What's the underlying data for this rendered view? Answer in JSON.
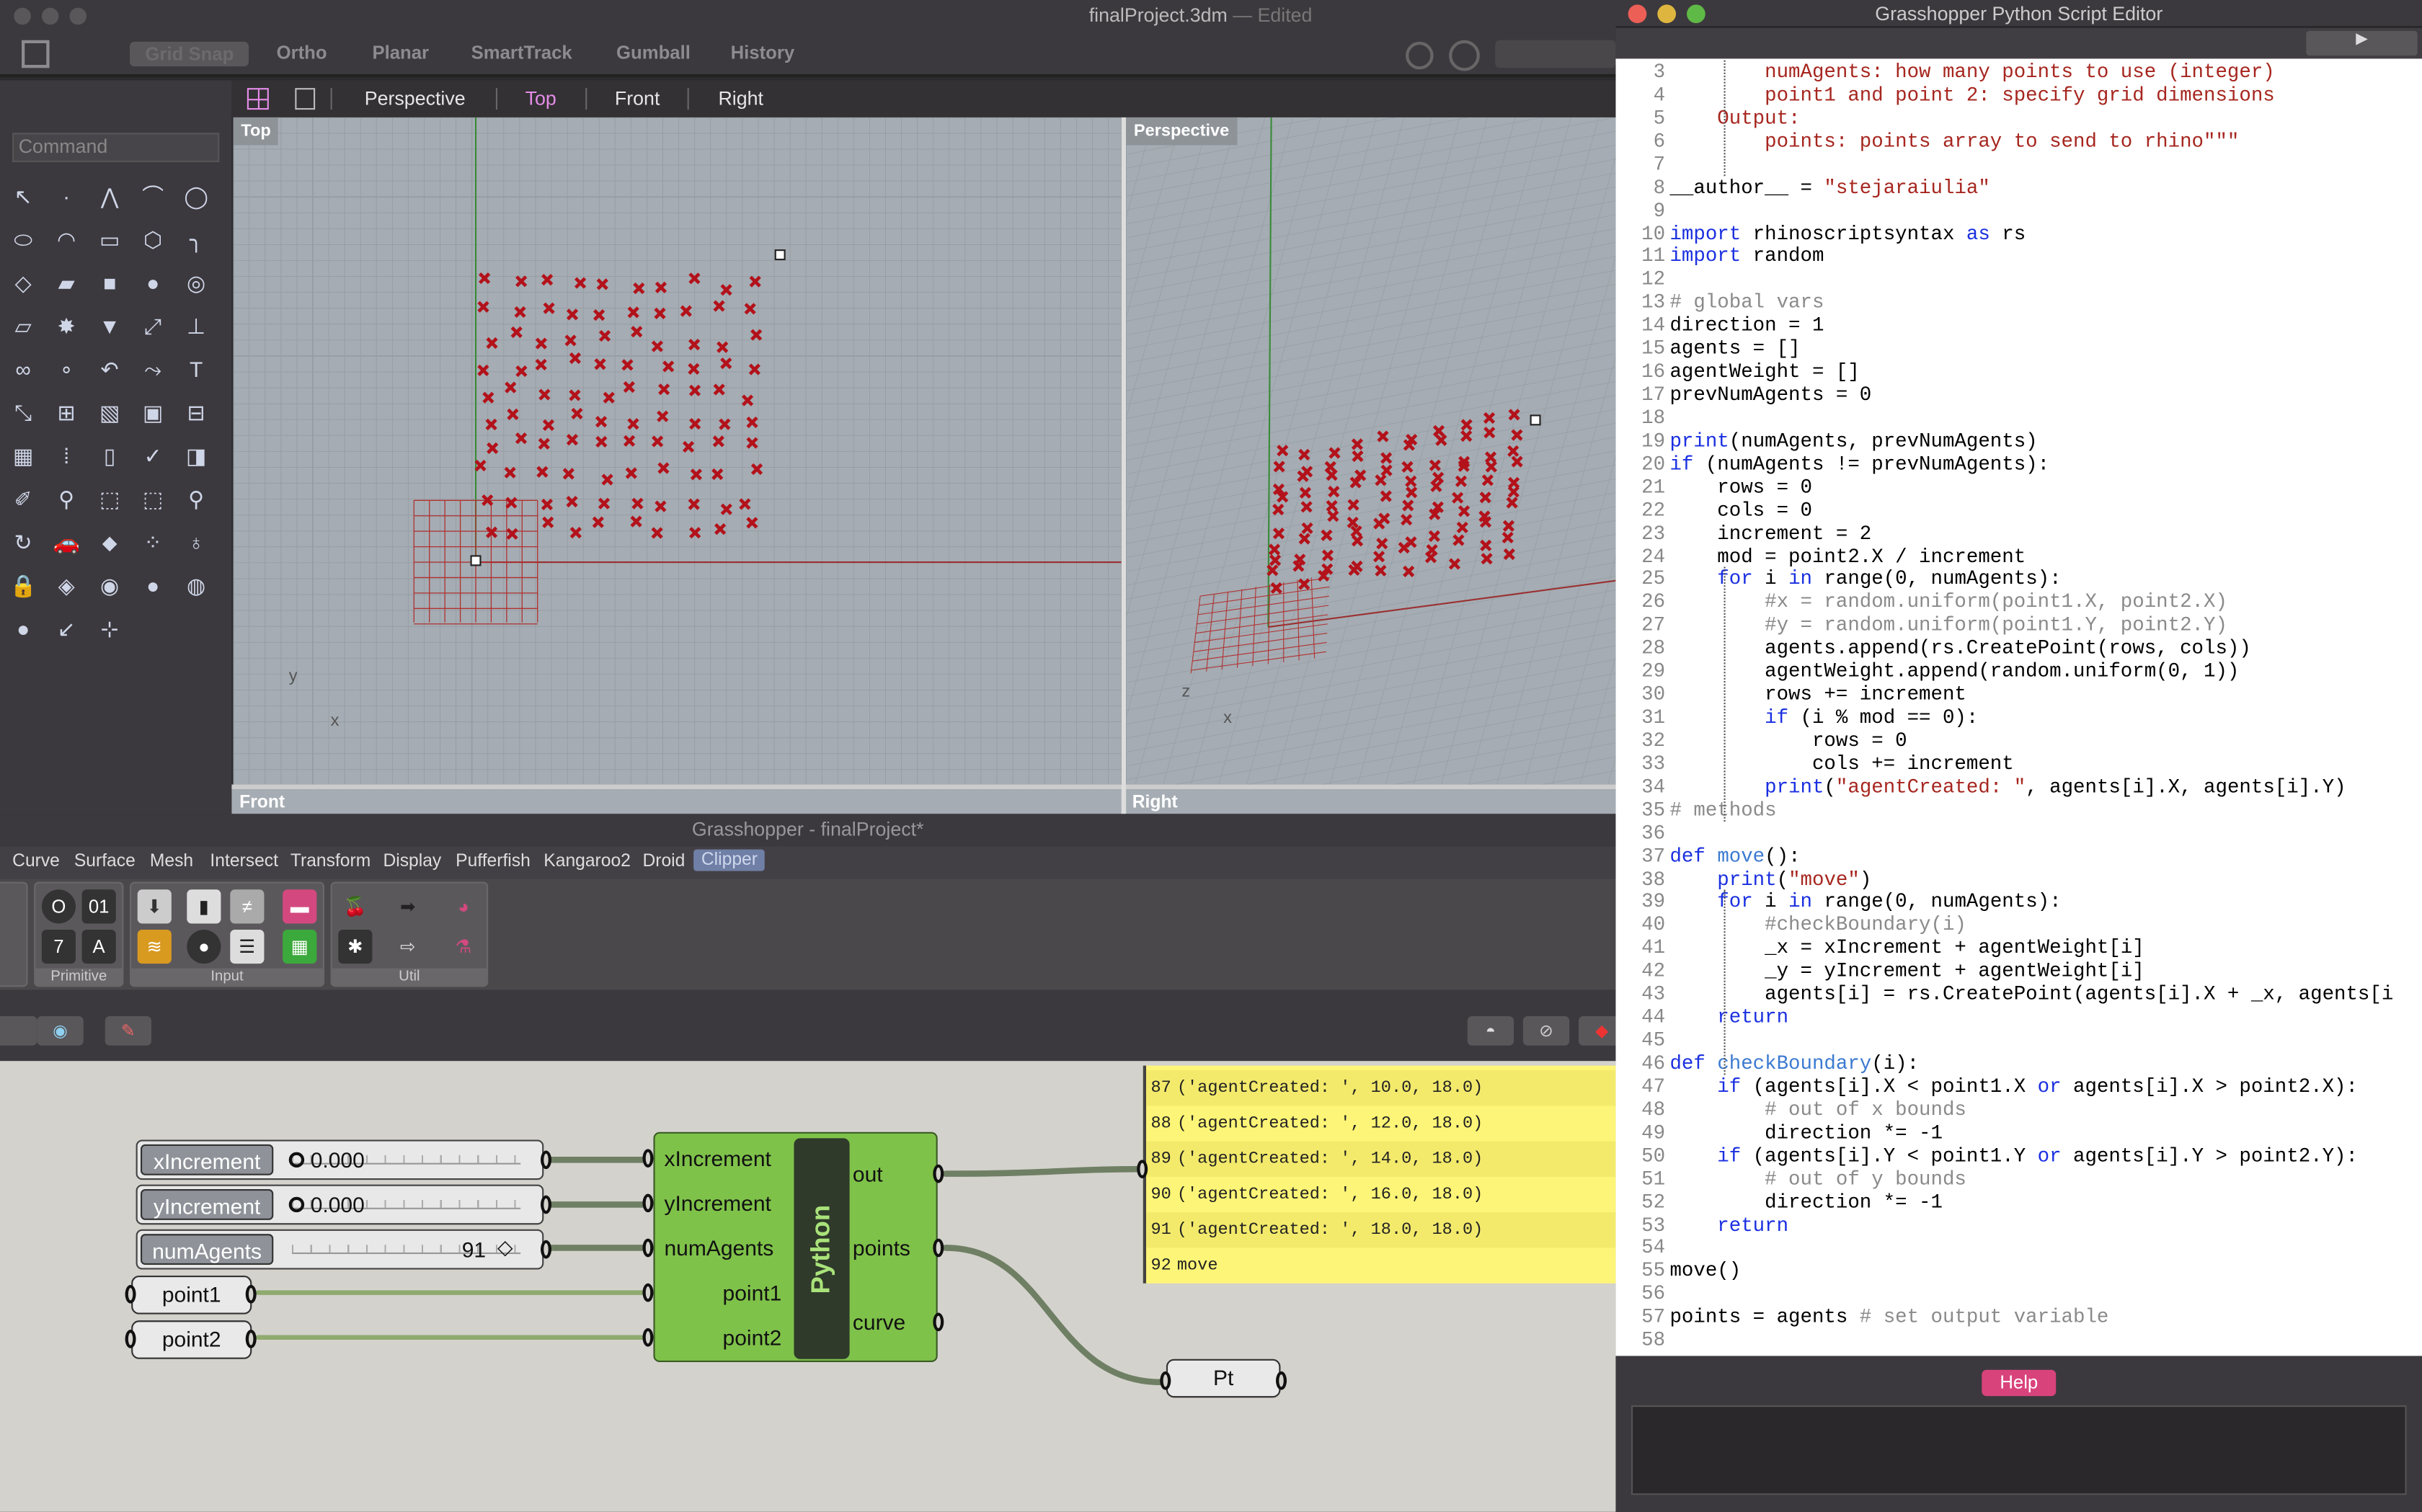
{
  "rhino": {
    "title": "finalProject.3dm",
    "title_status": "— Edited",
    "toggles": [
      "Grid Snap",
      "Ortho",
      "Planar",
      "SmartTrack",
      "Gumball",
      "History"
    ],
    "viewport_tabs": [
      "Perspective",
      "Top",
      "Front",
      "Right"
    ],
    "active_tab": "Top",
    "command_placeholder": "Command",
    "viewports": {
      "top": "Top",
      "perspective": "Perspective",
      "front": "Front",
      "right": "Right"
    },
    "axis_labels": {
      "x": "x",
      "y": "y",
      "z": "z"
    },
    "tool_icons": [
      "select-arrow-icon",
      "point-icon",
      "polyline-icon",
      "curve-icon",
      "circle-icon",
      "ellipse-icon",
      "arc-icon",
      "rectangle-icon",
      "polygon-icon",
      "fillet-icon",
      "surface-icon",
      "extrude-icon",
      "box-icon",
      "sphere-icon",
      "cylinder-icon",
      "plane-icon",
      "explode-icon",
      "analyze-icon",
      "split-icon",
      "trim-icon",
      "boolean-icon",
      "group-icon",
      "join-icon",
      "rebuild-icon",
      "text-icon",
      "transform-icon",
      "array-icon",
      "edit-icon",
      "solid-icon",
      "dimension-icon",
      "grid-icon",
      "mesh-icon",
      "layout-icon",
      "check-icon",
      "cube-icon",
      "paint-icon",
      "zoom-icon",
      "zoom-window-icon",
      "zoom-extents-icon",
      "zoom-selected-icon",
      "rotate-view-icon",
      "car-icon",
      "render-icon",
      "light-icon",
      "bulb-icon",
      "lock-icon",
      "shade-icon",
      "color-wheel-icon",
      "shaded-sphere-icon",
      "wire-sphere-icon",
      "material-sphere-icon",
      "pin-icon",
      "ortho-icon"
    ],
    "accent": "#e58ce8",
    "point_color": "#b3121b"
  },
  "grasshopper": {
    "title": "Grasshopper - finalProject*",
    "tabs": [
      "Curve",
      "Surface",
      "Mesh",
      "Intersect",
      "Transform",
      "Display",
      "Pufferfish",
      "Kangaroo2",
      "Droid",
      "Clipper"
    ],
    "active_tab": "Clipper",
    "groups": [
      "Primitive",
      "Input",
      "Util"
    ],
    "sliders": [
      {
        "name": "xIncrement",
        "value": "0.000"
      },
      {
        "name": "yIncrement",
        "value": "0.000"
      },
      {
        "name": "numAgents",
        "value": "91"
      }
    ],
    "params": [
      "point1",
      "point2"
    ],
    "python": {
      "label": "Python",
      "inputs": [
        "xIncrement",
        "yIncrement",
        "numAgents",
        "point1",
        "point2"
      ],
      "outputs": [
        "out",
        "points",
        "curve"
      ]
    },
    "panel_rows": [
      {
        "n": "87",
        "text": "('agentCreated: ', 10.0, 18.0)"
      },
      {
        "n": "88",
        "text": "('agentCreated: ', 12.0, 18.0)"
      },
      {
        "n": "89",
        "text": "('agentCreated: ', 14.0, 18.0)"
      },
      {
        "n": "90",
        "text": "('agentCreated: ', 16.0, 18.0)"
      },
      {
        "n": "91",
        "text": "('agentCreated: ', 18.0, 18.0)"
      },
      {
        "n": "92",
        "text": "move"
      }
    ],
    "pt_param": "Pt"
  },
  "editor": {
    "title": "Grasshopper Python Script Editor",
    "run_icon": "play-icon",
    "help_label": "Help",
    "lines": [
      {
        "n": "3",
        "t": [
          [
            "s",
            "        numAgents: how many points to use (integer)"
          ]
        ]
      },
      {
        "n": "4",
        "t": [
          [
            "s",
            "        point1 and point 2: specify grid dimensions"
          ]
        ]
      },
      {
        "n": "5",
        "t": [
          [
            "s",
            "    Output:"
          ]
        ]
      },
      {
        "n": "6",
        "t": [
          [
            "s",
            "        points: points array to send to rhino\"\"\""
          ]
        ]
      },
      {
        "n": "7",
        "t": []
      },
      {
        "n": "8",
        "t": [
          [
            "p",
            "__author__ = "
          ],
          [
            "s",
            "\"stejaraiulia\""
          ]
        ]
      },
      {
        "n": "9",
        "t": []
      },
      {
        "n": "10",
        "t": [
          [
            "k",
            "import"
          ],
          [
            "p",
            " rhinoscriptsyntax "
          ],
          [
            "k",
            "as"
          ],
          [
            "p",
            " rs"
          ]
        ]
      },
      {
        "n": "11",
        "t": [
          [
            "k",
            "import"
          ],
          [
            "p",
            " random"
          ]
        ]
      },
      {
        "n": "12",
        "t": []
      },
      {
        "n": "13",
        "t": [
          [
            "c",
            "# global vars"
          ]
        ]
      },
      {
        "n": "14",
        "t": [
          [
            "p",
            "direction = 1"
          ]
        ]
      },
      {
        "n": "15",
        "t": [
          [
            "p",
            "agents = []"
          ]
        ]
      },
      {
        "n": "16",
        "t": [
          [
            "p",
            "agentWeight = []"
          ]
        ]
      },
      {
        "n": "17",
        "t": [
          [
            "p",
            "prevNumAgents = 0"
          ]
        ]
      },
      {
        "n": "18",
        "t": []
      },
      {
        "n": "19",
        "t": [
          [
            "k",
            "print"
          ],
          [
            "p",
            "(numAgents, prevNumAgents)"
          ]
        ]
      },
      {
        "n": "20",
        "t": [
          [
            "k",
            "if"
          ],
          [
            "p",
            " (numAgents != prevNumAgents):"
          ]
        ]
      },
      {
        "n": "21",
        "t": [
          [
            "p",
            "    rows = 0"
          ]
        ]
      },
      {
        "n": "22",
        "t": [
          [
            "p",
            "    cols = 0"
          ]
        ]
      },
      {
        "n": "23",
        "t": [
          [
            "p",
            "    increment = 2"
          ]
        ]
      },
      {
        "n": "24",
        "t": [
          [
            "p",
            "    mod = point2.X / increment"
          ]
        ]
      },
      {
        "n": "25",
        "t": [
          [
            "p",
            "    "
          ],
          [
            "k",
            "for"
          ],
          [
            "p",
            " i "
          ],
          [
            "k",
            "in"
          ],
          [
            "p",
            " range(0, numAgents):"
          ]
        ]
      },
      {
        "n": "26",
        "t": [
          [
            "c",
            "        #x = random.uniform(point1.X, point2.X)"
          ]
        ]
      },
      {
        "n": "27",
        "t": [
          [
            "c",
            "        #y = random.uniform(point1.Y, point2.Y)"
          ]
        ]
      },
      {
        "n": "28",
        "t": [
          [
            "p",
            "        agents.append(rs.CreatePoint(rows, cols))"
          ]
        ]
      },
      {
        "n": "29",
        "t": [
          [
            "p",
            "        agentWeight.append(random.uniform(0, 1))"
          ]
        ]
      },
      {
        "n": "30",
        "t": [
          [
            "p",
            "        rows += increment"
          ]
        ]
      },
      {
        "n": "31",
        "t": [
          [
            "p",
            "        "
          ],
          [
            "k",
            "if"
          ],
          [
            "p",
            " (i % mod == 0):"
          ]
        ]
      },
      {
        "n": "32",
        "t": [
          [
            "p",
            "            rows = 0"
          ]
        ]
      },
      {
        "n": "33",
        "t": [
          [
            "p",
            "            cols += increment"
          ]
        ]
      },
      {
        "n": "34",
        "t": [
          [
            "p",
            "        "
          ],
          [
            "k",
            "print"
          ],
          [
            "p",
            "("
          ],
          [
            "s",
            "\"agentCreated: \""
          ],
          [
            "p",
            ", agents[i].X, agents[i].Y)"
          ]
        ]
      },
      {
        "n": "35",
        "t": [
          [
            "c",
            "# methods"
          ]
        ]
      },
      {
        "n": "36",
        "t": []
      },
      {
        "n": "37",
        "t": [
          [
            "k",
            "def"
          ],
          [
            "f",
            " move"
          ],
          [
            "p",
            "():"
          ]
        ]
      },
      {
        "n": "38",
        "t": [
          [
            "p",
            "    "
          ],
          [
            "k",
            "print"
          ],
          [
            "p",
            "("
          ],
          [
            "s",
            "\"move\""
          ],
          [
            "p",
            ")"
          ]
        ]
      },
      {
        "n": "39",
        "t": [
          [
            "p",
            "    "
          ],
          [
            "k",
            "for"
          ],
          [
            "p",
            " i "
          ],
          [
            "k",
            "in"
          ],
          [
            "p",
            " range(0, numAgents):"
          ]
        ]
      },
      {
        "n": "40",
        "t": [
          [
            "c",
            "        #checkBoundary(i)"
          ]
        ]
      },
      {
        "n": "41",
        "t": [
          [
            "p",
            "        _x = xIncrement + agentWeight[i]"
          ]
        ]
      },
      {
        "n": "42",
        "t": [
          [
            "p",
            "        _y = yIncrement + agentWeight[i]"
          ]
        ]
      },
      {
        "n": "43",
        "t": [
          [
            "p",
            "        agents[i] = rs.CreatePoint(agents[i].X + _x, agents[i"
          ]
        ]
      },
      {
        "n": "44",
        "t": [
          [
            "p",
            "    "
          ],
          [
            "k",
            "return"
          ]
        ]
      },
      {
        "n": "45",
        "t": []
      },
      {
        "n": "46",
        "t": [
          [
            "k",
            "def"
          ],
          [
            "f",
            " checkBoundary"
          ],
          [
            "p",
            "(i):"
          ]
        ]
      },
      {
        "n": "47",
        "t": [
          [
            "p",
            "    "
          ],
          [
            "k",
            "if"
          ],
          [
            "p",
            " (agents[i].X < point1.X "
          ],
          [
            "k",
            "or"
          ],
          [
            "p",
            " agents[i].X > point2.X):"
          ]
        ]
      },
      {
        "n": "48",
        "t": [
          [
            "c",
            "        # out of x bounds"
          ]
        ]
      },
      {
        "n": "49",
        "t": [
          [
            "p",
            "        direction *= -1"
          ]
        ]
      },
      {
        "n": "50",
        "t": [
          [
            "p",
            "    "
          ],
          [
            "k",
            "if"
          ],
          [
            "p",
            " (agents[i].Y < point1.Y "
          ],
          [
            "k",
            "or"
          ],
          [
            "p",
            " agents[i].Y > point2.Y):"
          ]
        ]
      },
      {
        "n": "51",
        "t": [
          [
            "c",
            "        # out of y bounds"
          ]
        ]
      },
      {
        "n": "52",
        "t": [
          [
            "p",
            "        direction *= -1"
          ]
        ]
      },
      {
        "n": "53",
        "t": [
          [
            "p",
            "    "
          ],
          [
            "k",
            "return"
          ]
        ]
      },
      {
        "n": "54",
        "t": []
      },
      {
        "n": "55",
        "t": [
          [
            "p",
            "move()"
          ]
        ]
      },
      {
        "n": "56",
        "t": []
      },
      {
        "n": "57",
        "t": [
          [
            "p",
            "points = agents "
          ],
          [
            "c",
            "# set output variable"
          ]
        ]
      },
      {
        "n": "58",
        "t": []
      }
    ]
  }
}
